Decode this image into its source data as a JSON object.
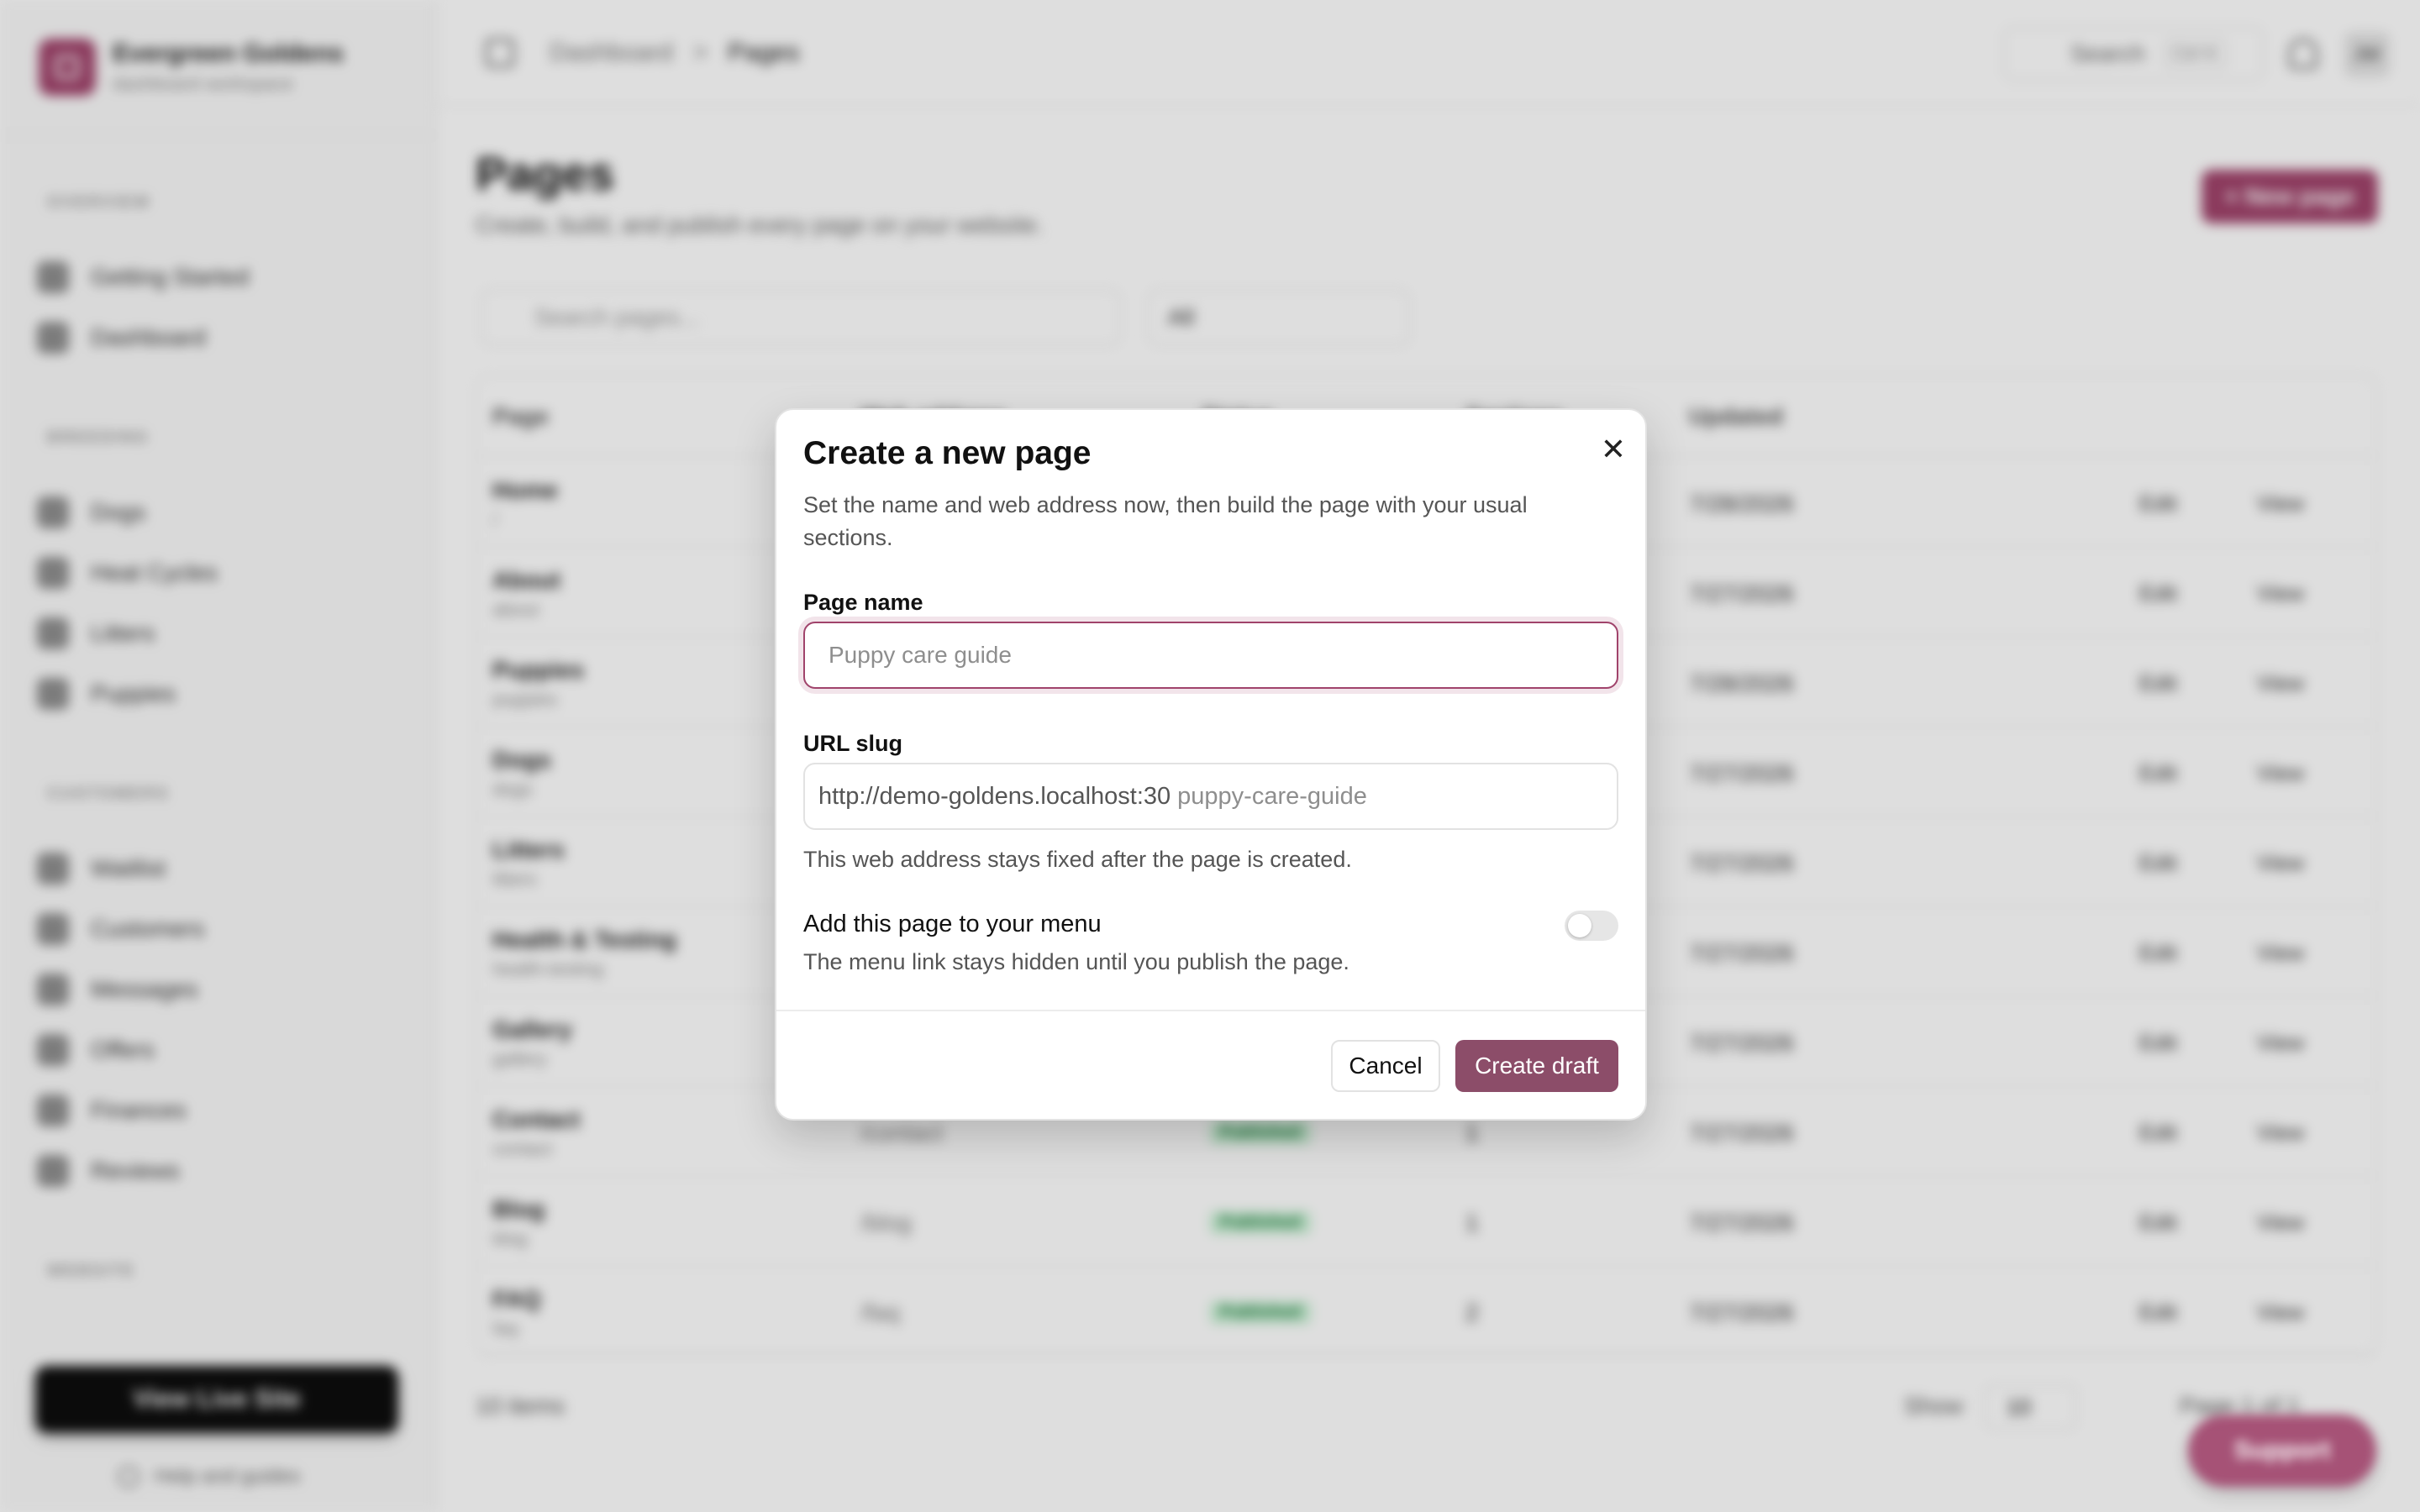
{
  "app": {
    "brand_name": "Evergreen Goldens",
    "brand_sub": "dashboard workspace",
    "sections": [
      "OVERVIEW",
      "BREEDING",
      "CUSTOMERS",
      "WEBSITE"
    ],
    "sidebar_items": [
      {
        "label": "Getting Started"
      },
      {
        "label": "Dashboard"
      },
      {
        "label": "Dogs"
      },
      {
        "label": "Heat Cycles"
      },
      {
        "label": "Litters"
      },
      {
        "label": "Puppies"
      },
      {
        "label": "Waitlist"
      },
      {
        "label": "Customers"
      },
      {
        "label": "Messages"
      },
      {
        "label": "Offers"
      },
      {
        "label": "Finances"
      },
      {
        "label": "Reviews"
      }
    ],
    "live_site_label": "View Live Site",
    "help_label": "Help and guides"
  },
  "topbar": {
    "breadcrumb": [
      "Dashboard",
      ">",
      "Pages"
    ],
    "search_label": "Search",
    "search_kbd": "Ctrl K",
    "avatar_initials": "JW"
  },
  "page": {
    "title": "Pages",
    "subtitle": "Create, build, and publish every page on your website.",
    "new_page_label": "+ New page",
    "search_placeholder": "Search pages...",
    "filter_value": "All",
    "columns": [
      "Page",
      "Web address",
      "Status",
      "Sections",
      "Updated"
    ],
    "rows": [
      {
        "name": "Home",
        "slug": "/",
        "address": "",
        "status": "",
        "sections": "",
        "updated": "7/28/2026"
      },
      {
        "name": "About",
        "slug": "about",
        "address": "",
        "status": "",
        "sections": "",
        "updated": "7/27/2026"
      },
      {
        "name": "Puppies",
        "slug": "puppies",
        "address": "",
        "status": "",
        "sections": "",
        "updated": "7/28/2026"
      },
      {
        "name": "Dogs",
        "slug": "dogs",
        "address": "",
        "status": "",
        "sections": "",
        "updated": "7/27/2026"
      },
      {
        "name": "Litters",
        "slug": "litters",
        "address": "",
        "status": "",
        "sections": "",
        "updated": "7/27/2026"
      },
      {
        "name": "Health & Testing",
        "slug": "health-testing",
        "address": "",
        "status": "",
        "sections": "",
        "updated": "7/27/2026"
      },
      {
        "name": "Gallery",
        "slug": "gallery",
        "address": "",
        "status": "",
        "sections": "",
        "updated": "7/27/2026"
      },
      {
        "name": "Contact",
        "slug": "contact",
        "address": "/contact",
        "status": "Published",
        "sections": "1",
        "updated": "7/27/2026"
      },
      {
        "name": "Blog",
        "slug": "blog",
        "address": "/blog",
        "status": "Published",
        "sections": "1",
        "updated": "7/27/2026"
      },
      {
        "name": "FAQ",
        "slug": "faq",
        "address": "/faq",
        "status": "Published",
        "sections": "2",
        "updated": "7/27/2026"
      }
    ],
    "edit_label": "Edit",
    "view_label": "View",
    "footer_count": "10 items",
    "show_label": "Show",
    "per_page": "10",
    "pager_label": "Page 1 of 1",
    "support_label": "Support"
  },
  "modal": {
    "title": "Create a new page",
    "description": "Set the name and web address now, then build the page with your usual sections.",
    "name_label": "Page name",
    "name_placeholder": "Puppy care guide",
    "name_value": "",
    "slug_label": "URL slug",
    "slug_prefix": "http://demo-goldens.localhost:30",
    "slug_placeholder": "puppy-care-guide",
    "slug_value": "",
    "slug_help": "This web address stays fixed after the page is created.",
    "menu_title": "Add this page to your menu",
    "menu_help": "The menu link stays hidden until you publish the page.",
    "menu_toggle_on": false,
    "close_icon": "close-icon",
    "cancel_label": "Cancel",
    "create_label": "Create draft"
  },
  "colors": {
    "accent": "#a0436b",
    "create_button": "#8c4d69",
    "overlay": "rgba(0,0,0,0.13)"
  }
}
